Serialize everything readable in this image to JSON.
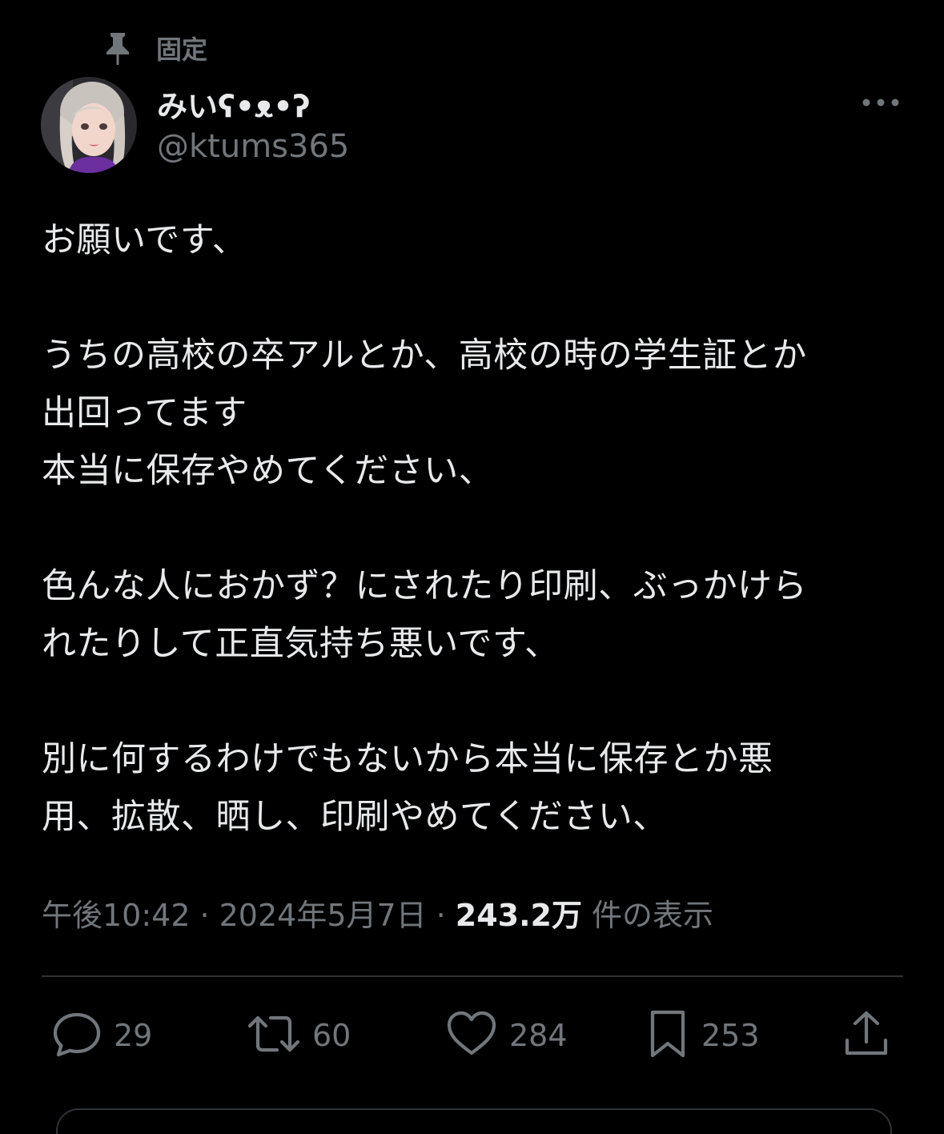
{
  "pinned": {
    "label": "固定",
    "icon": "pin-icon"
  },
  "author": {
    "display_name": "みいʕ•ᴥ•ʔ",
    "handle": "@ktums365"
  },
  "tweet": {
    "text": "お願いです、\n\nうちの高校の卒アルとか、高校の時の学生証とか\n出回ってます\n本当に保存やめてください、\n\n 色んな人におかず？にされたり印刷、ぶっかけら\nれたりして正直気持ち悪いです、\n\n別に何するわけでもないから本当に保存とか悪\n用、拡散、晒し、印刷やめてください、"
  },
  "meta": {
    "time": "午後10:42",
    "separator": "·",
    "date": "2024年5月7日",
    "views_count": "243.2万",
    "views_label": "件の表示"
  },
  "actions": {
    "reply": {
      "icon": "reply-icon",
      "count": "29"
    },
    "retweet": {
      "icon": "retweet-icon",
      "count": "60"
    },
    "like": {
      "icon": "heart-icon",
      "count": "284"
    },
    "bookmark": {
      "icon": "bookmark-icon",
      "count": "253"
    },
    "share": {
      "icon": "share-icon"
    }
  },
  "colors": {
    "background": "#000000",
    "primary_text": "#e7e9ea",
    "secondary_text": "#71767b",
    "divider": "#2f3336"
  }
}
